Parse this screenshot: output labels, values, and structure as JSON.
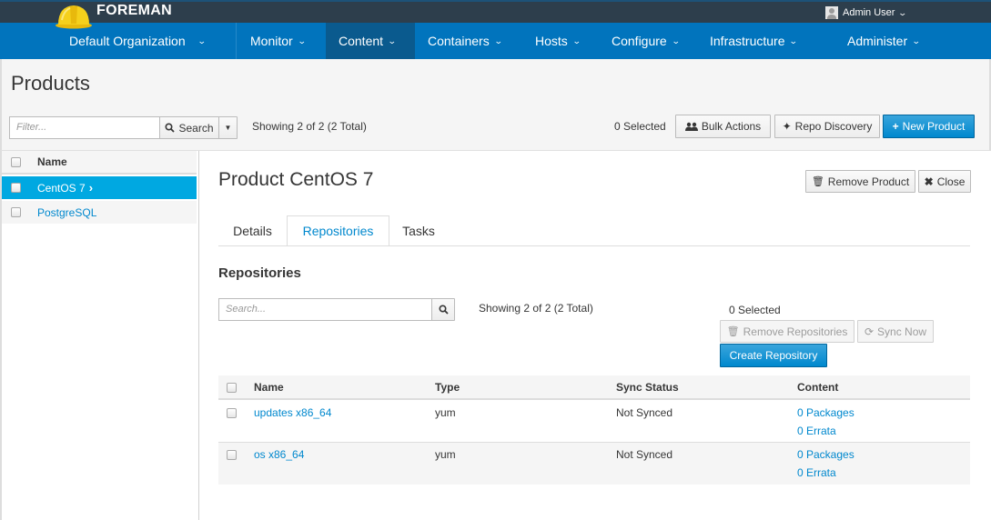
{
  "header": {
    "brand": "FOREMAN",
    "user": "Admin User"
  },
  "nav": {
    "organization": "Default Organization",
    "items": [
      "Monitor",
      "Content",
      "Containers",
      "Hosts",
      "Configure",
      "Infrastructure",
      "Administer"
    ],
    "active": "Content"
  },
  "page": {
    "title": "Products",
    "filter_placeholder": "Filter...",
    "search_label": "Search",
    "showing": "Showing 2 of 2 (2 Total)",
    "selected": "0 Selected",
    "bulk_actions": "Bulk Actions",
    "repo_discovery": "Repo Discovery",
    "new_product": "New Product"
  },
  "product_list": {
    "header": "Name",
    "items": [
      {
        "name": "CentOS 7",
        "selected": true
      },
      {
        "name": "PostgreSQL",
        "selected": false
      }
    ]
  },
  "detail": {
    "title": "Product CentOS 7",
    "remove_product": "Remove Product",
    "close": "Close",
    "tabs": [
      "Details",
      "Repositories",
      "Tasks"
    ],
    "active_tab": "Repositories",
    "section_heading": "Repositories",
    "search_placeholder": "Search...",
    "showing": "Showing 2 of 2 (2 Total)",
    "selected": "0 Selected",
    "remove_repositories": "Remove Repositories",
    "sync_now": "Sync Now",
    "create_repository": "Create Repository",
    "table": {
      "columns": [
        "Name",
        "Type",
        "Sync Status",
        "Content"
      ],
      "rows": [
        {
          "name": "updates x86_64",
          "type": "yum",
          "sync_status": "Not Synced",
          "packages": "0 Packages",
          "errata": "0 Errata"
        },
        {
          "name": "os x86_64",
          "type": "yum",
          "sync_status": "Not Synced",
          "packages": "0 Packages",
          "errata": "0 Errata"
        }
      ]
    }
  },
  "colors": {
    "topbar": "#2d3e4c",
    "navbar": "#0174bd",
    "nav_active": "#0a5a8e",
    "primary": "#0088ce",
    "selected_row": "#00a8e1"
  }
}
